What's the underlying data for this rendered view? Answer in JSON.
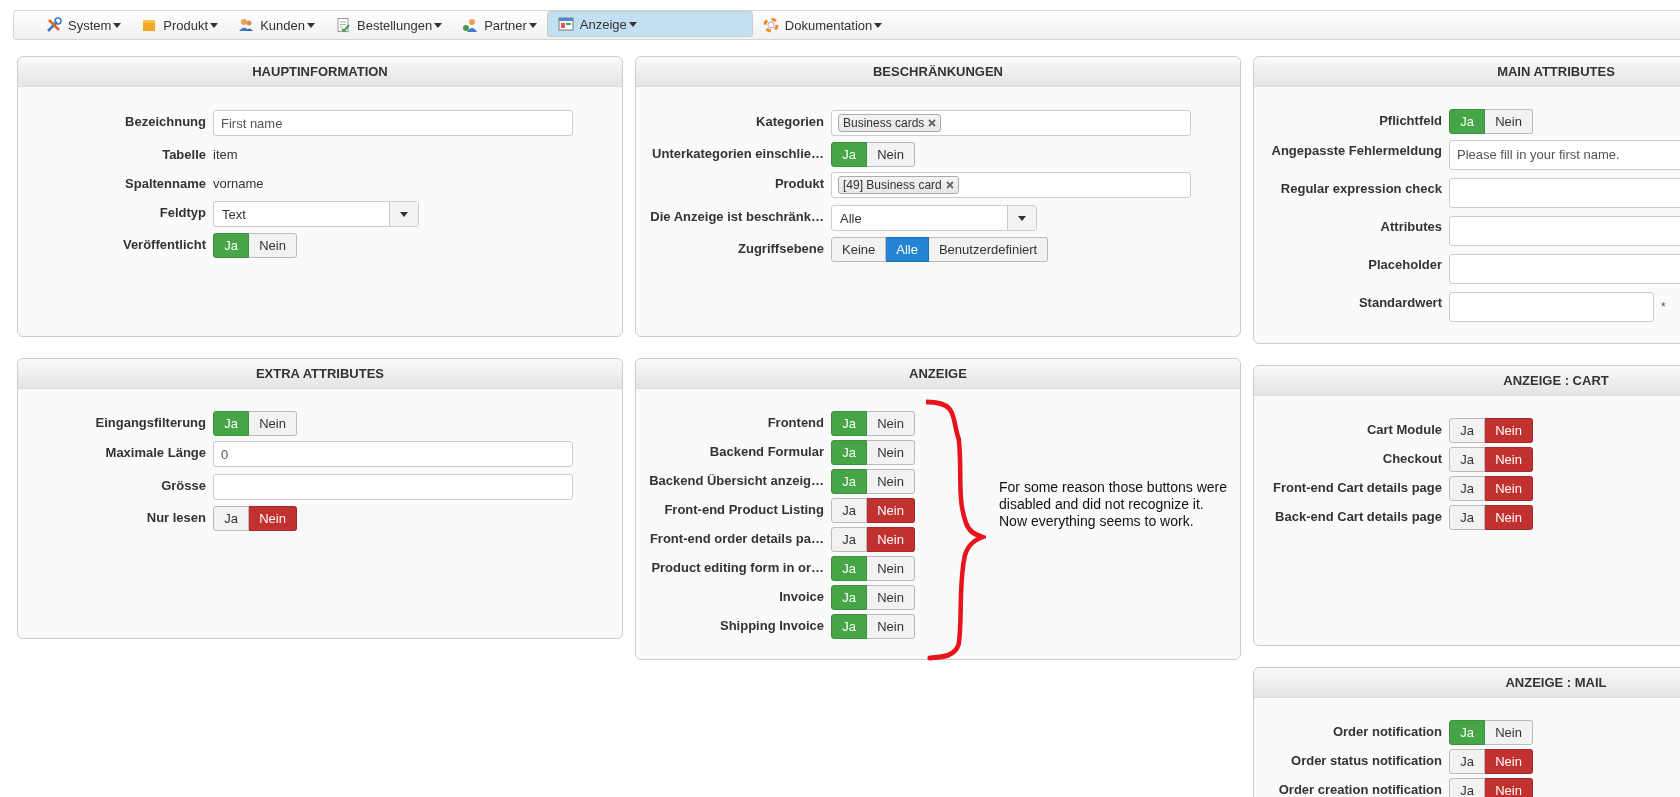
{
  "menu": [
    {
      "label": "System",
      "selected": false
    },
    {
      "label": "Produkt",
      "selected": false
    },
    {
      "label": "Kunden",
      "selected": false
    },
    {
      "label": "Bestellungen",
      "selected": false
    },
    {
      "label": "Partner",
      "selected": false
    },
    {
      "label": "Anzeige",
      "selected": true
    },
    {
      "label": "Dokumentation",
      "selected": false
    }
  ],
  "columns": [
    [
      {
        "title": "HAUPTINFORMATION",
        "rows": [
          {
            "kind": "input",
            "label": "Bezeichnung",
            "value": "First name"
          },
          {
            "kind": "text",
            "label": "Tabelle",
            "value": "item"
          },
          {
            "kind": "text",
            "label": "Spaltenname",
            "value": "vorname"
          },
          {
            "kind": "select",
            "label": "Feldtyp",
            "value": "Text"
          },
          {
            "kind": "toggle",
            "label": "Veröffentlicht",
            "options": [
              {
                "label": "Ja",
                "kind": "yes",
                "selected": true
              },
              {
                "label": "Nein",
                "kind": "no",
                "selected": false
              }
            ]
          }
        ]
      },
      {
        "title": "EXTRA ATTRIBUTES",
        "rows": [
          {
            "kind": "toggle",
            "label": "Eingangsfilterung",
            "options": [
              {
                "label": "Ja",
                "kind": "yes",
                "selected": true
              },
              {
                "label": "Nein",
                "kind": "no",
                "selected": false
              }
            ]
          },
          {
            "kind": "input",
            "label": "Maximale Länge",
            "value": "0"
          },
          {
            "kind": "input",
            "label": "Grösse"
          },
          {
            "kind": "toggle",
            "label": "Nur lesen",
            "options": [
              {
                "label": "Ja",
                "kind": "yes",
                "selected": false
              },
              {
                "label": "Nein",
                "kind": "no",
                "selected": true
              }
            ]
          }
        ]
      }
    ],
    [
      {
        "title": "BESCHRÄNKUNGEN",
        "rows": [
          {
            "kind": "tags",
            "label": "Kategorien",
            "tags": [
              "Business cards"
            ]
          },
          {
            "kind": "toggle",
            "label": "Unterkategorien einschlie…",
            "options": [
              {
                "label": "Ja",
                "kind": "yes",
                "selected": true
              },
              {
                "label": "Nein",
                "kind": "no",
                "selected": false
              }
            ]
          },
          {
            "kind": "tags",
            "label": "Produkt",
            "tags": [
              "[49] Business card"
            ]
          },
          {
            "kind": "select",
            "label": "Die Anzeige ist beschränk…",
            "value": "Alle"
          },
          {
            "kind": "toggle",
            "label": "Zugriffsebene",
            "options": [
              {
                "label": "Keine",
                "kind": "plain",
                "selected": false
              },
              {
                "label": "Alle",
                "kind": "primary",
                "selected": true
              },
              {
                "label": "Benutzerdefiniert",
                "kind": "plain",
                "selected": false
              }
            ]
          }
        ]
      },
      {
        "title": "ANZEIGE",
        "note": "For some reason those buttons were disabled and did not recognize it. Now everything seems to work.",
        "rows": [
          {
            "kind": "toggle",
            "label": "Frontend",
            "options": [
              {
                "label": "Ja",
                "kind": "yes",
                "selected": true
              },
              {
                "label": "Nein",
                "kind": "no",
                "selected": false
              }
            ]
          },
          {
            "kind": "toggle",
            "label": "Backend Formular",
            "options": [
              {
                "label": "Ja",
                "kind": "yes",
                "selected": true
              },
              {
                "label": "Nein",
                "kind": "no",
                "selected": false
              }
            ]
          },
          {
            "kind": "toggle",
            "label": "Backend Übersicht anzeig…",
            "options": [
              {
                "label": "Ja",
                "kind": "yes",
                "selected": true
              },
              {
                "label": "Nein",
                "kind": "no",
                "selected": false
              }
            ]
          },
          {
            "kind": "toggle",
            "label": "Front-end Product Listing",
            "options": [
              {
                "label": "Ja",
                "kind": "yes",
                "selected": false
              },
              {
                "label": "Nein",
                "kind": "no",
                "selected": true
              }
            ]
          },
          {
            "kind": "toggle",
            "label": "Front-end order details pa…",
            "options": [
              {
                "label": "Ja",
                "kind": "yes",
                "selected": false
              },
              {
                "label": "Nein",
                "kind": "no",
                "selected": true
              }
            ]
          },
          {
            "kind": "toggle",
            "label": "Product editing form in or…",
            "options": [
              {
                "label": "Ja",
                "kind": "yes",
                "selected": true
              },
              {
                "label": "Nein",
                "kind": "no",
                "selected": false
              }
            ]
          },
          {
            "kind": "toggle",
            "label": "Invoice",
            "options": [
              {
                "label": "Ja",
                "kind": "yes",
                "selected": true
              },
              {
                "label": "Nein",
                "kind": "no",
                "selected": false
              }
            ]
          },
          {
            "kind": "toggle",
            "label": "Shipping Invoice",
            "options": [
              {
                "label": "Ja",
                "kind": "yes",
                "selected": true
              },
              {
                "label": "Nein",
                "kind": "no",
                "selected": false
              }
            ]
          }
        ]
      }
    ],
    [
      {
        "title": "MAIN ATTRIBUTES",
        "rows": [
          {
            "kind": "toggle",
            "label": "Pflichtfeld",
            "options": [
              {
                "label": "Ja",
                "kind": "yes",
                "selected": true
              },
              {
                "label": "Nein",
                "kind": "no",
                "selected": false
              }
            ]
          },
          {
            "kind": "input",
            "label": "Angepasste Fehlermeldung",
            "value": "Please fill in your first name."
          },
          {
            "kind": "input",
            "label": "Regular expression check"
          },
          {
            "kind": "input",
            "label": "Attributes"
          },
          {
            "kind": "input",
            "label": "Placeholder"
          },
          {
            "kind": "input",
            "label": "Standardwert",
            "suffix": "*"
          }
        ]
      },
      {
        "title": "ANZEIGE : CART",
        "rows": [
          {
            "kind": "toggle",
            "label": "Cart Module",
            "options": [
              {
                "label": "Ja",
                "kind": "yes",
                "selected": false
              },
              {
                "label": "Nein",
                "kind": "no",
                "selected": true
              }
            ]
          },
          {
            "kind": "toggle",
            "label": "Checkout",
            "options": [
              {
                "label": "Ja",
                "kind": "yes",
                "selected": false
              },
              {
                "label": "Nein",
                "kind": "no",
                "selected": true
              }
            ]
          },
          {
            "kind": "toggle",
            "label": "Front-end Cart details page",
            "options": [
              {
                "label": "Ja",
                "kind": "yes",
                "selected": false
              },
              {
                "label": "Nein",
                "kind": "no",
                "selected": true
              }
            ]
          },
          {
            "kind": "toggle",
            "label": "Back-end Cart details page",
            "options": [
              {
                "label": "Ja",
                "kind": "yes",
                "selected": false
              },
              {
                "label": "Nein",
                "kind": "no",
                "selected": true
              }
            ]
          }
        ]
      },
      {
        "title": "ANZEIGE : MAIL",
        "rows": [
          {
            "kind": "toggle",
            "label": "Order notification",
            "options": [
              {
                "label": "Ja",
                "kind": "yes",
                "selected": true
              },
              {
                "label": "Nein",
                "kind": "no",
                "selected": false
              }
            ]
          },
          {
            "kind": "toggle",
            "label": "Order status notification",
            "options": [
              {
                "label": "Ja",
                "kind": "yes",
                "selected": false
              },
              {
                "label": "Nein",
                "kind": "no",
                "selected": true
              }
            ]
          },
          {
            "kind": "toggle",
            "label": "Order creation notification",
            "options": [
              {
                "label": "Ja",
                "kind": "yes",
                "selected": false
              },
              {
                "label": "Nein",
                "kind": "no",
                "selected": true
              }
            ]
          }
        ]
      }
    ]
  ]
}
